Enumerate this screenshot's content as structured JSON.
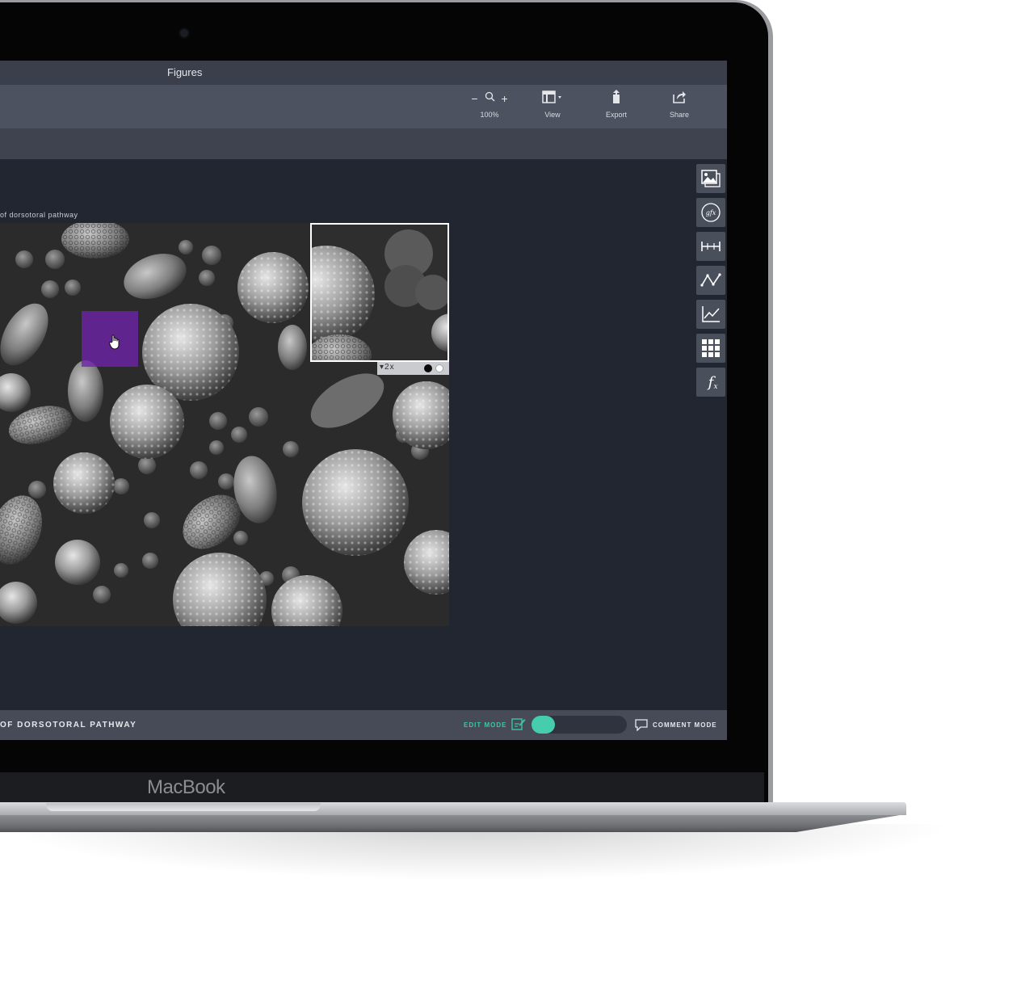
{
  "device": {
    "brand": "MacBook"
  },
  "window": {
    "title": "Figures"
  },
  "toolbar": {
    "zoom": {
      "label": "100%",
      "zoom_out": "−",
      "zoom_in": "+"
    },
    "view_label": "View",
    "export_label": "Export",
    "share_label": "Share"
  },
  "figure": {
    "caption": "of dorsotoral pathway",
    "zoom_inset": {
      "magnification": "▾2x"
    },
    "selection_color": "#6e22aa"
  },
  "tools": [
    {
      "name": "image-tool",
      "icon": "image-stack-icon"
    },
    {
      "name": "gfx-tool",
      "icon": "gfx-circle-icon",
      "text": "gfx"
    },
    {
      "name": "scale-bar-tool",
      "icon": "scale-bar-icon"
    },
    {
      "name": "line-tool",
      "icon": "polyline-icon"
    },
    {
      "name": "chart-tool",
      "icon": "line-chart-icon"
    },
    {
      "name": "grid-tool",
      "icon": "grid-icon"
    },
    {
      "name": "formula-tool",
      "icon": "function-icon",
      "text": "fx"
    }
  ],
  "statusbar": {
    "title": "OF DORSOTORAL PATHWAY",
    "edit_mode_label": "EDIT MODE",
    "comment_mode_label": "COMMENT MODE",
    "accent": "#46cdae"
  }
}
